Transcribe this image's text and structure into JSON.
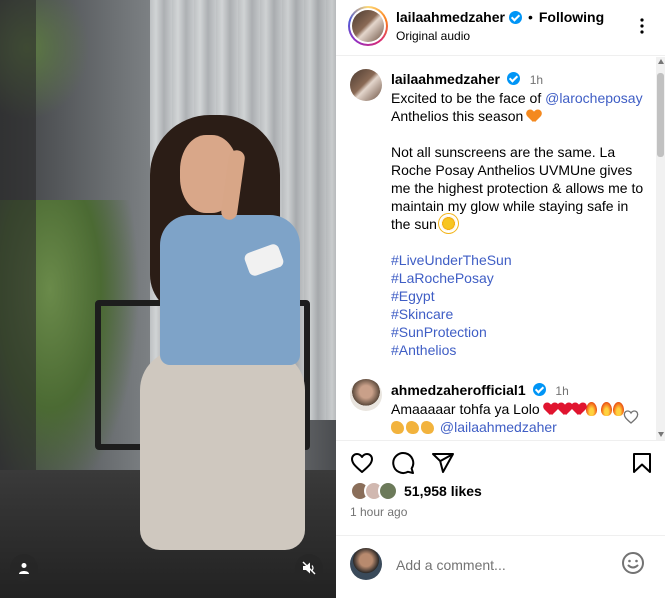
{
  "header": {
    "username": "lailaahmedzaher",
    "separator": "•",
    "follow_status": "Following",
    "audio": "Original audio"
  },
  "caption": {
    "username": "lailaahmedzaher",
    "time": "1h",
    "line1_text": "Excited to be the face of ",
    "mention": "@larocheposay",
    "line2_text": "Anthelios this season",
    "paragraph2": "Not all sunscreens are the same. La Roche Posay Anthelios UVMUne gives me the highest protection & allows me to maintain my glow while staying safe in the sun",
    "hashtags": [
      "#LiveUnderTheSun",
      "#LaRochePosay",
      "#Egypt",
      "#Skincare",
      "#SunProtection",
      "#Anthelios"
    ]
  },
  "comment": {
    "username": "ahmedzaherofficial1",
    "time": "1h",
    "text": "Amaaaaar tohfa ya Lolo",
    "mention": "@lailaahmedzaher"
  },
  "engagement": {
    "likes": "51,958 likes",
    "posted": "1 hour ago"
  },
  "composer": {
    "placeholder": "Add a comment..."
  },
  "colors": {
    "verified": "#0095f6",
    "link": "#3f5ec5",
    "muted": "#737373"
  },
  "icons": [
    "more-icon",
    "heart-icon",
    "comment-icon",
    "share-icon",
    "bookmark-icon",
    "emoji-icon",
    "user-tag-icon",
    "mute-icon"
  ]
}
